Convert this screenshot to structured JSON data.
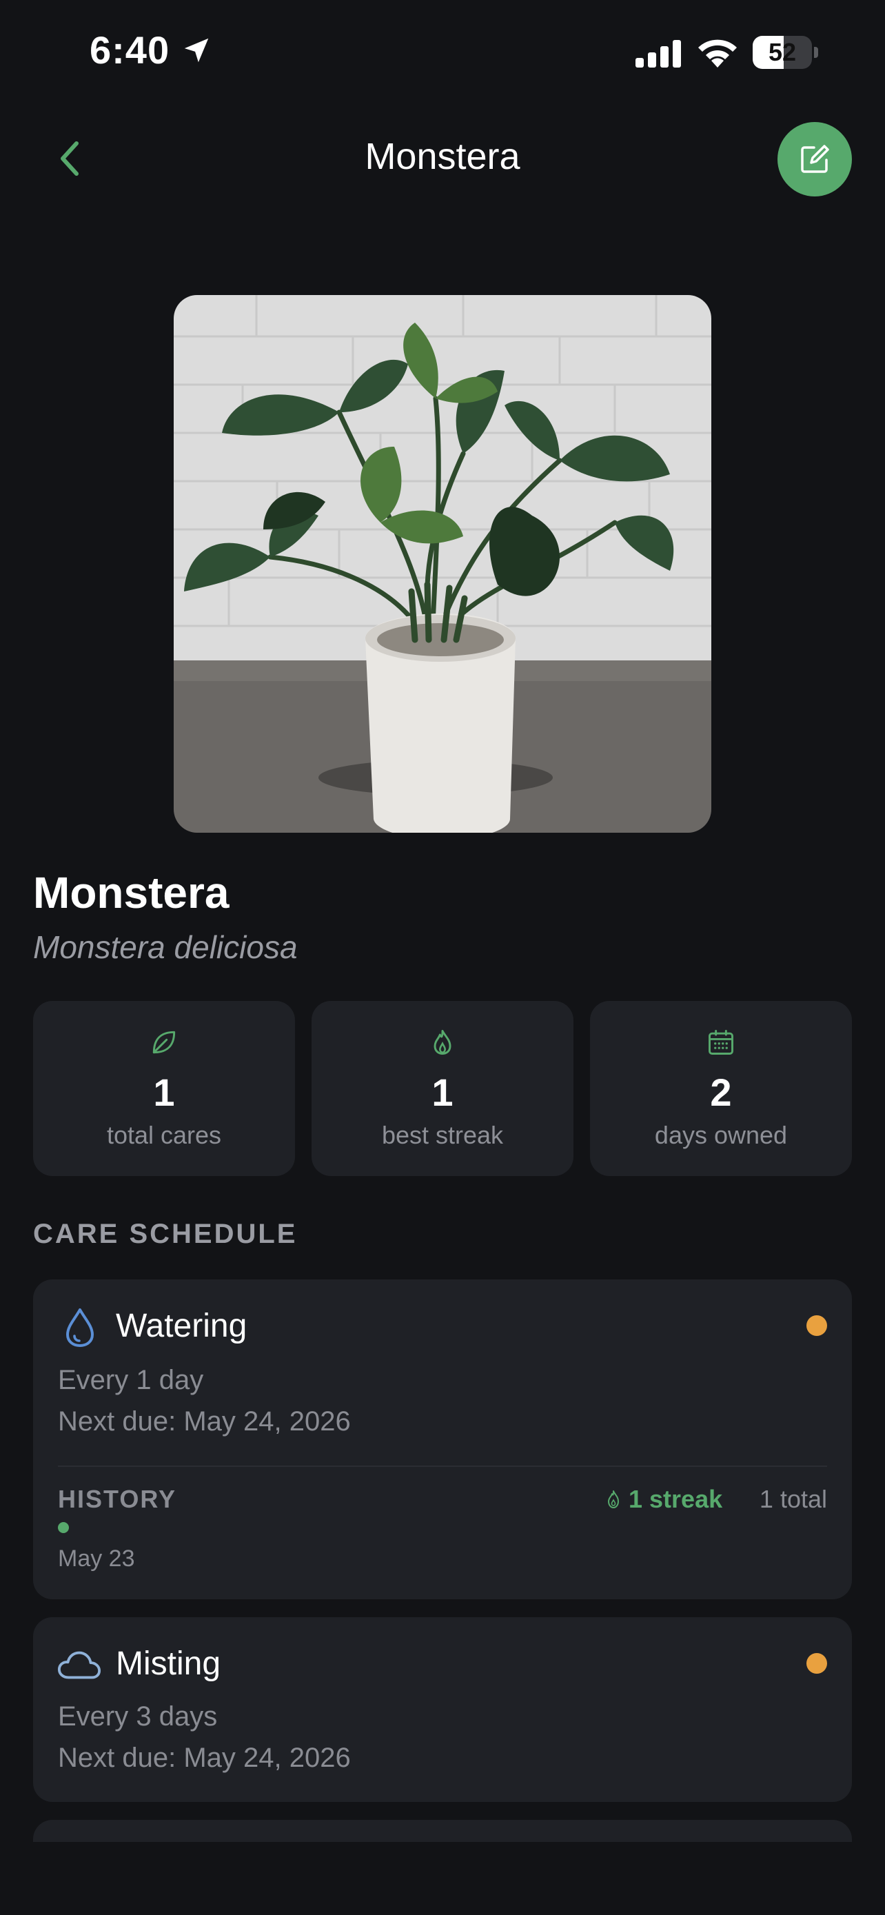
{
  "status_bar": {
    "time": "6:40",
    "battery": "52",
    "battery_level": 0.52
  },
  "header": {
    "title": "Monstera"
  },
  "plant": {
    "name": "Monstera",
    "scientific_name": "Monstera deliciosa"
  },
  "stats": [
    {
      "icon": "leaf-icon",
      "value": "1",
      "label": "total cares"
    },
    {
      "icon": "flame-icon",
      "value": "1",
      "label": "best streak"
    },
    {
      "icon": "calendar-icon",
      "value": "2",
      "label": "days owned"
    }
  ],
  "care_schedule": {
    "title": "CARE SCHEDULE",
    "items": [
      {
        "name": "Watering",
        "icon": "water-drop-icon",
        "frequency": "Every 1 day",
        "next_due": "Next due: May 24, 2026",
        "history": {
          "label": "HISTORY",
          "streak": "1 streak",
          "total": "1 total",
          "entries": [
            "May 23"
          ]
        }
      },
      {
        "name": "Misting",
        "icon": "cloud-icon",
        "frequency": "Every 3 days",
        "next_due": "Next due: May 24, 2026"
      }
    ]
  },
  "colors": {
    "accent": "#57a96c",
    "due": "#e9a13f",
    "card": "#1f2126",
    "background": "#121316"
  }
}
